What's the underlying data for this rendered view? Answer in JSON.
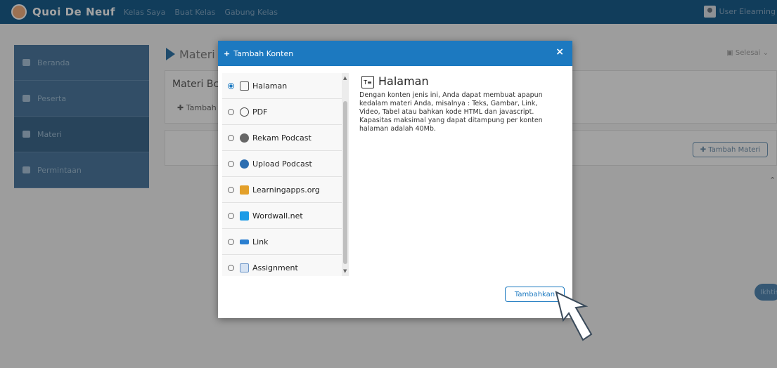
{
  "navbar": {
    "brand": "Quoi De Neuf",
    "links": [
      "Kelas Saya",
      "Buat Kelas",
      "Gabung Kelas"
    ],
    "user": "User Elearning"
  },
  "sidebar": {
    "items": [
      {
        "label": "Beranda",
        "icon": "home-icon"
      },
      {
        "label": "Peserta",
        "icon": "users-icon"
      },
      {
        "label": "Materi",
        "icon": "book-icon"
      },
      {
        "label": "Permintaan",
        "icon": "envelope-icon"
      }
    ]
  },
  "main": {
    "title": "Materi",
    "done_label": "Selesai",
    "card_title": "Materi Bc",
    "card_add": "Tambah",
    "add_materi": "Tambah Materi",
    "ikhtisar": "Ikhtisar"
  },
  "modal": {
    "title": "Tambah Konten",
    "close": "×",
    "options": [
      {
        "label": "Halaman",
        "selected": true,
        "icon_color": "#555555"
      },
      {
        "label": "PDF",
        "selected": false,
        "icon_color": "#444444"
      },
      {
        "label": "Rekam Podcast",
        "selected": false,
        "icon_color": "#555555"
      },
      {
        "label": "Upload Podcast",
        "selected": false,
        "icon_color": "#2b6db0"
      },
      {
        "label": "Learningapps.org",
        "selected": false,
        "icon_color": "#e3a02a"
      },
      {
        "label": "Wordwall.net",
        "selected": false,
        "icon_color": "#1c9be6"
      },
      {
        "label": "Link",
        "selected": false,
        "icon_color": "#2b7fd0"
      },
      {
        "label": "Assignment",
        "selected": false,
        "icon_color": "#6c95c8"
      }
    ],
    "detail": {
      "title": "Halaman",
      "icon_text": "T≡",
      "body": "Dengan konten jenis ini, Anda dapat membuat apapun kedalam materi Anda, misalnya : Teks, Gambar, Link, Video, Tabel atau bahkan kode HTML dan javascript. Kapasitas maksimal yang dapat ditampung per konten halaman adalah 40Mb."
    },
    "submit": "Tambahkan"
  }
}
